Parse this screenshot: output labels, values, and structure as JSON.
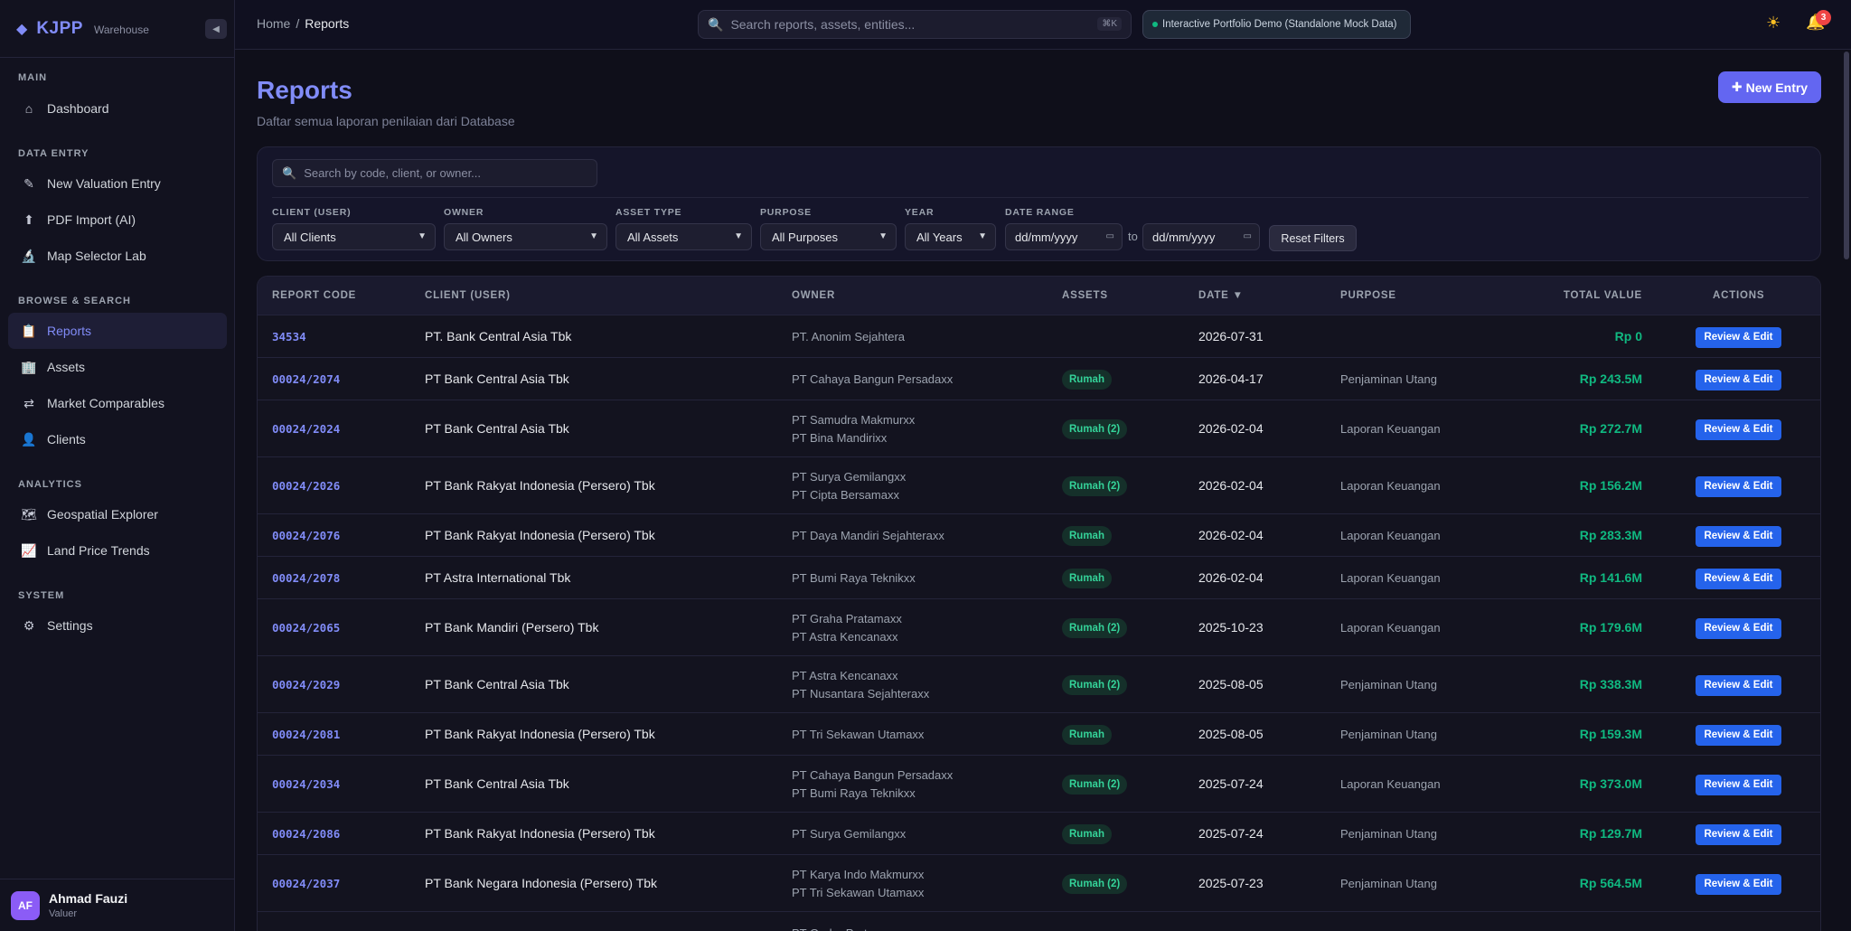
{
  "brand": {
    "name": "KJPP",
    "sub": "Warehouse"
  },
  "sidebar": {
    "sections": [
      {
        "title": "MAIN",
        "items": [
          {
            "label": "Dashboard",
            "icon": "home-icon"
          }
        ]
      },
      {
        "title": "DATA ENTRY",
        "items": [
          {
            "label": "New Valuation Entry",
            "icon": "pencil-icon"
          },
          {
            "label": "PDF Import (AI)",
            "icon": "upload-icon"
          },
          {
            "label": "Map Selector Lab",
            "icon": "microscope-icon"
          }
        ]
      },
      {
        "title": "BROWSE & SEARCH",
        "items": [
          {
            "label": "Reports",
            "icon": "clipboard-icon"
          },
          {
            "label": "Assets",
            "icon": "building-icon"
          },
          {
            "label": "Market Comparables",
            "icon": "swap-icon"
          },
          {
            "label": "Clients",
            "icon": "user-icon"
          }
        ]
      },
      {
        "title": "ANALYTICS",
        "items": [
          {
            "label": "Geospatial Explorer",
            "icon": "map-icon"
          },
          {
            "label": "Land Price Trends",
            "icon": "chart-icon"
          }
        ]
      },
      {
        "title": "SYSTEM",
        "items": [
          {
            "label": "Settings",
            "icon": "gear-icon"
          }
        ]
      }
    ],
    "active": "Reports"
  },
  "user": {
    "initials": "AF",
    "name": "Ahmad Fauzi",
    "role": "Valuer"
  },
  "topbar": {
    "breadcrumb_home": "Home",
    "breadcrumb_sep": "/",
    "breadcrumb_current": "Reports",
    "search_placeholder": "Search reports, assets, entities...",
    "search_shortcut": "⌘K",
    "demo_badge": "Interactive Portfolio Demo (Standalone Mock Data)",
    "notifications": "3"
  },
  "page": {
    "title": "Reports",
    "subtitle": "Daftar semua laporan penilaian dari Database",
    "new_entry": "New Entry"
  },
  "filters": {
    "search_placeholder": "Search by code, client, or owner...",
    "client_label": "CLIENT (USER)",
    "client_value": "All Clients",
    "owner_label": "OWNER",
    "owner_value": "All Owners",
    "asset_label": "ASSET TYPE",
    "asset_value": "All Assets",
    "purpose_label": "PURPOSE",
    "purpose_value": "All Purposes",
    "year_label": "YEAR",
    "year_value": "All Years",
    "date_label": "DATE RANGE",
    "date_from": "dd/mm/yyyy",
    "date_to": "dd/mm/yyyy",
    "to": "to",
    "reset": "Reset Filters"
  },
  "table": {
    "headers": {
      "code": "REPORT CODE",
      "client": "CLIENT (USER)",
      "owner": "OWNER",
      "assets": "ASSETS",
      "date": "DATE ▼",
      "purpose": "PURPOSE",
      "value": "TOTAL VALUE",
      "actions": "ACTIONS"
    },
    "action_label": "Review & Edit",
    "rows": [
      {
        "code": "34534",
        "client": "PT. Bank Central Asia Tbk",
        "owners": [
          "PT. Anonim Sejahtera"
        ],
        "assets": "",
        "date": "2026-07-31",
        "purpose": "",
        "value": "Rp 0"
      },
      {
        "code": "00024/2074",
        "client": "PT Bank Central Asia Tbk",
        "owners": [
          "PT Cahaya Bangun Persadaxx"
        ],
        "assets": "Rumah",
        "date": "2026-04-17",
        "purpose": "Penjaminan Utang",
        "value": "Rp 243.5M"
      },
      {
        "code": "00024/2024",
        "client": "PT Bank Central Asia Tbk",
        "owners": [
          "PT Samudra Makmurxx",
          "PT Bina Mandirixx"
        ],
        "assets": "Rumah (2)",
        "date": "2026-02-04",
        "purpose": "Laporan Keuangan",
        "value": "Rp 272.7M"
      },
      {
        "code": "00024/2026",
        "client": "PT Bank Rakyat Indonesia (Persero) Tbk",
        "owners": [
          "PT Surya Gemilangxx",
          "PT Cipta Bersamaxx"
        ],
        "assets": "Rumah (2)",
        "date": "2026-02-04",
        "purpose": "Laporan Keuangan",
        "value": "Rp 156.2M"
      },
      {
        "code": "00024/2076",
        "client": "PT Bank Rakyat Indonesia (Persero) Tbk",
        "owners": [
          "PT Daya Mandiri Sejahteraxx"
        ],
        "assets": "Rumah",
        "date": "2026-02-04",
        "purpose": "Laporan Keuangan",
        "value": "Rp 283.3M"
      },
      {
        "code": "00024/2078",
        "client": "PT Astra International Tbk",
        "owners": [
          "PT Bumi Raya Teknikxx"
        ],
        "assets": "Rumah",
        "date": "2026-02-04",
        "purpose": "Laporan Keuangan",
        "value": "Rp 141.6M"
      },
      {
        "code": "00024/2065",
        "client": "PT Bank Mandiri (Persero) Tbk",
        "owners": [
          "PT Graha Pratamaxx",
          "PT Astra Kencanaxx"
        ],
        "assets": "Rumah (2)",
        "date": "2025-10-23",
        "purpose": "Laporan Keuangan",
        "value": "Rp 179.6M"
      },
      {
        "code": "00024/2029",
        "client": "PT Bank Central Asia Tbk",
        "owners": [
          "PT Astra Kencanaxx",
          "PT Nusantara Sejahteraxx"
        ],
        "assets": "Rumah (2)",
        "date": "2025-08-05",
        "purpose": "Penjaminan Utang",
        "value": "Rp 338.3M"
      },
      {
        "code": "00024/2081",
        "client": "PT Bank Rakyat Indonesia (Persero) Tbk",
        "owners": [
          "PT Tri Sekawan Utamaxx"
        ],
        "assets": "Rumah",
        "date": "2025-08-05",
        "purpose": "Penjaminan Utang",
        "value": "Rp 159.3M"
      },
      {
        "code": "00024/2034",
        "client": "PT Bank Central Asia Tbk",
        "owners": [
          "PT Cahaya Bangun Persadaxx",
          "PT Bumi Raya Teknikxx"
        ],
        "assets": "Rumah (2)",
        "date": "2025-07-24",
        "purpose": "Laporan Keuangan",
        "value": "Rp 373.0M"
      },
      {
        "code": "00024/2086",
        "client": "PT Bank Rakyat Indonesia (Persero) Tbk",
        "owners": [
          "PT Surya Gemilangxx"
        ],
        "assets": "Rumah",
        "date": "2025-07-24",
        "purpose": "Penjaminan Utang",
        "value": "Rp 129.7M"
      },
      {
        "code": "00024/2037",
        "client": "PT Bank Negara Indonesia (Persero) Tbk",
        "owners": [
          "PT Karya Indo Makmurxx",
          "PT Tri Sekawan Utamaxx"
        ],
        "assets": "Rumah (2)",
        "date": "2025-07-23",
        "purpose": "Penjaminan Utang",
        "value": "Rp 564.5M"
      },
      {
        "code": "",
        "client": "",
        "owners": [
          "PT Graha Pratamaxx"
        ],
        "assets": "",
        "date": "",
        "purpose": "",
        "value": ""
      }
    ]
  }
}
